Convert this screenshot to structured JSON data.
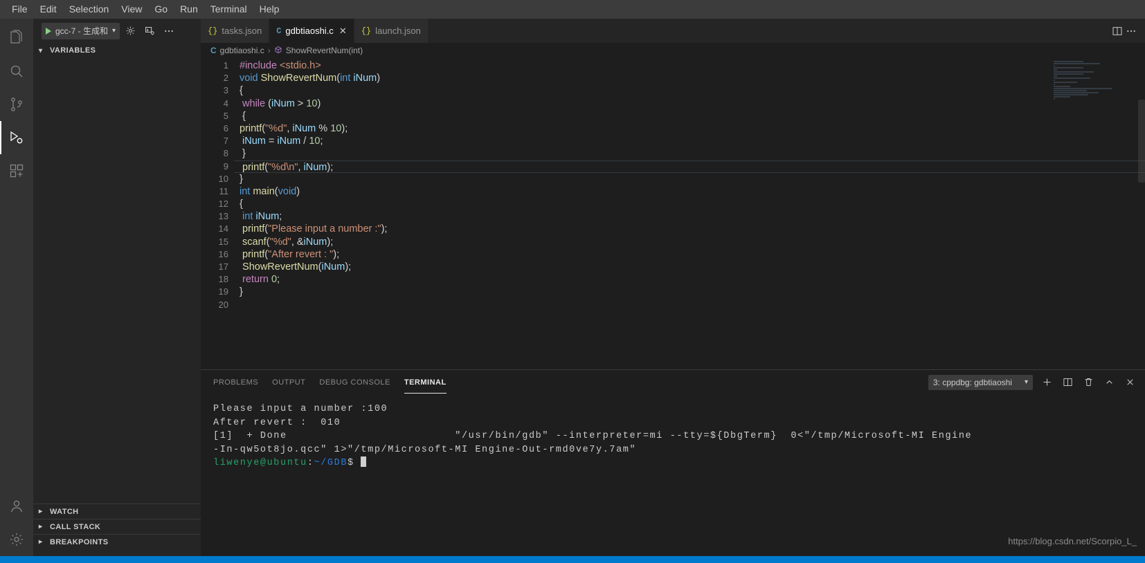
{
  "menubar": {
    "items": [
      {
        "label": "File"
      },
      {
        "label": "Edit"
      },
      {
        "label": "Selection"
      },
      {
        "label": "View"
      },
      {
        "label": "Go"
      },
      {
        "label": "Run"
      },
      {
        "label": "Terminal"
      },
      {
        "label": "Help"
      }
    ]
  },
  "activitybar": {
    "items": [
      {
        "name": "explorer",
        "icon": "files-icon"
      },
      {
        "name": "search",
        "icon": "search-icon"
      },
      {
        "name": "source-control",
        "icon": "source-control-icon"
      },
      {
        "name": "run-and-debug",
        "icon": "run-debug-icon",
        "active": true
      },
      {
        "name": "extensions",
        "icon": "extensions-icon"
      }
    ],
    "bottom": [
      {
        "name": "accounts",
        "icon": "account-icon"
      },
      {
        "name": "manage",
        "icon": "gear-icon"
      }
    ]
  },
  "debug_toolbar": {
    "launch_config": "gcc-7 - 生成和",
    "start_icon": "play-icon",
    "settings_icon": "gear-icon",
    "open_debug_console_icon": "debug-console-icon",
    "more_icon": "ellipsis-icon"
  },
  "sidebar": {
    "sections": [
      {
        "label": "VARIABLES",
        "expanded": true
      },
      {
        "label": "WATCH",
        "expanded": false
      },
      {
        "label": "CALL STACK",
        "expanded": false
      },
      {
        "label": "BREAKPOINTS",
        "expanded": false
      }
    ]
  },
  "tabs": [
    {
      "label": "tasks.json",
      "icon": "json",
      "icon_glyph": "{}",
      "active": false,
      "closable": false
    },
    {
      "label": "gdbtiaoshi.c",
      "icon": "c",
      "icon_glyph": "C",
      "active": true,
      "closable": true,
      "close_glyph": "✕"
    },
    {
      "label": "launch.json",
      "icon": "json",
      "icon_glyph": "{}",
      "active": false,
      "closable": false
    }
  ],
  "editor_actions": {
    "split_editor_icon": "split-editor-icon",
    "more_actions_icon": "ellipsis-icon"
  },
  "breadcrumb": {
    "file_icon_glyph": "C",
    "file": "gdbtiaoshi.c",
    "separator": "›",
    "symbol_icon": "symbol-method-icon",
    "symbol": "ShowRevertNum(int)"
  },
  "code": {
    "language": "c",
    "current_line": 9,
    "lines": [
      {
        "n": 1,
        "tokens": [
          {
            "t": "#include ",
            "c": "pp"
          },
          {
            "t": "<stdio.h>",
            "c": "inc"
          }
        ]
      },
      {
        "n": 2,
        "tokens": [
          {
            "t": "void ",
            "c": "kw"
          },
          {
            "t": "ShowRevertNum",
            "c": "fn"
          },
          {
            "t": "(",
            "c": "op"
          },
          {
            "t": "int ",
            "c": "kw"
          },
          {
            "t": "iNum",
            "c": "var"
          },
          {
            "t": ")",
            "c": "op"
          }
        ]
      },
      {
        "n": 3,
        "tokens": [
          {
            "t": "{",
            "c": "op"
          }
        ]
      },
      {
        "n": 4,
        "tokens": [
          {
            "t": " ",
            "c": "op"
          },
          {
            "t": "while",
            "c": "kw2"
          },
          {
            "t": " (",
            "c": "op"
          },
          {
            "t": "iNum",
            "c": "var"
          },
          {
            "t": " > ",
            "c": "op"
          },
          {
            "t": "10",
            "c": "num"
          },
          {
            "t": ")",
            "c": "op"
          }
        ]
      },
      {
        "n": 5,
        "tokens": [
          {
            "t": " {",
            "c": "op"
          }
        ]
      },
      {
        "n": 6,
        "tokens": [
          {
            "t": "printf",
            "c": "fn"
          },
          {
            "t": "(",
            "c": "op"
          },
          {
            "t": "\"%d\"",
            "c": "str"
          },
          {
            "t": ", ",
            "c": "op"
          },
          {
            "t": "iNum",
            "c": "var"
          },
          {
            "t": " % ",
            "c": "op"
          },
          {
            "t": "10",
            "c": "num"
          },
          {
            "t": ");",
            "c": "op"
          }
        ]
      },
      {
        "n": 7,
        "tokens": [
          {
            "t": " ",
            "c": "op"
          },
          {
            "t": "iNum",
            "c": "var"
          },
          {
            "t": " = ",
            "c": "op"
          },
          {
            "t": "iNum",
            "c": "var"
          },
          {
            "t": " / ",
            "c": "op"
          },
          {
            "t": "10",
            "c": "num"
          },
          {
            "t": ";",
            "c": "op"
          }
        ]
      },
      {
        "n": 8,
        "tokens": [
          {
            "t": " }",
            "c": "op"
          }
        ]
      },
      {
        "n": 9,
        "tokens": [
          {
            "t": " ",
            "c": "op"
          },
          {
            "t": "printf",
            "c": "fn"
          },
          {
            "t": "(",
            "c": "op"
          },
          {
            "t": "\"%d\\n\"",
            "c": "str"
          },
          {
            "t": ", ",
            "c": "op"
          },
          {
            "t": "iNum",
            "c": "var"
          },
          {
            "t": ");",
            "c": "op"
          }
        ]
      },
      {
        "n": 10,
        "tokens": [
          {
            "t": "}",
            "c": "op"
          }
        ]
      },
      {
        "n": 11,
        "tokens": [
          {
            "t": "int ",
            "c": "kw"
          },
          {
            "t": "main",
            "c": "fn"
          },
          {
            "t": "(",
            "c": "op"
          },
          {
            "t": "void",
            "c": "kw"
          },
          {
            "t": ")",
            "c": "op"
          }
        ]
      },
      {
        "n": 12,
        "tokens": [
          {
            "t": "{",
            "c": "op"
          }
        ]
      },
      {
        "n": 13,
        "tokens": [
          {
            "t": " ",
            "c": "op"
          },
          {
            "t": "int ",
            "c": "kw"
          },
          {
            "t": "iNum",
            "c": "var"
          },
          {
            "t": ";",
            "c": "op"
          }
        ]
      },
      {
        "n": 14,
        "tokens": [
          {
            "t": " ",
            "c": "op"
          },
          {
            "t": "printf",
            "c": "fn"
          },
          {
            "t": "(",
            "c": "op"
          },
          {
            "t": "\"Please input a number :\"",
            "c": "str"
          },
          {
            "t": ");",
            "c": "op"
          }
        ]
      },
      {
        "n": 15,
        "tokens": [
          {
            "t": " ",
            "c": "op"
          },
          {
            "t": "scanf",
            "c": "fn"
          },
          {
            "t": "(",
            "c": "op"
          },
          {
            "t": "\"%d\"",
            "c": "str"
          },
          {
            "t": ", &",
            "c": "op"
          },
          {
            "t": "iNum",
            "c": "var"
          },
          {
            "t": ");",
            "c": "op"
          }
        ]
      },
      {
        "n": 16,
        "tokens": [
          {
            "t": " ",
            "c": "op"
          },
          {
            "t": "printf",
            "c": "fn"
          },
          {
            "t": "(",
            "c": "op"
          },
          {
            "t": "\"After revert : \"",
            "c": "str"
          },
          {
            "t": ");",
            "c": "op"
          }
        ]
      },
      {
        "n": 17,
        "tokens": [
          {
            "t": " ",
            "c": "op"
          },
          {
            "t": "ShowRevertNum",
            "c": "fn"
          },
          {
            "t": "(",
            "c": "op"
          },
          {
            "t": "iNum",
            "c": "var"
          },
          {
            "t": ");",
            "c": "op"
          }
        ]
      },
      {
        "n": 18,
        "tokens": [
          {
            "t": " ",
            "c": "op"
          },
          {
            "t": "return",
            "c": "kw2"
          },
          {
            "t": " ",
            "c": "op"
          },
          {
            "t": "0",
            "c": "num"
          },
          {
            "t": ";",
            "c": "op"
          }
        ]
      },
      {
        "n": 19,
        "tokens": [
          {
            "t": "}",
            "c": "op"
          }
        ]
      },
      {
        "n": 20,
        "tokens": []
      }
    ]
  },
  "panel": {
    "tabs": [
      {
        "label": "PROBLEMS",
        "active": false
      },
      {
        "label": "OUTPUT",
        "active": false
      },
      {
        "label": "DEBUG CONSOLE",
        "active": false
      },
      {
        "label": "TERMINAL",
        "active": true
      }
    ],
    "terminal_selector": {
      "value": "3: cppdbg: gdbtiaoshi",
      "chevron": "⌄"
    },
    "actions": [
      {
        "name": "new-terminal-icon",
        "glyph": "+"
      },
      {
        "name": "split-terminal-icon",
        "glyph": "◫"
      },
      {
        "name": "kill-terminal-icon",
        "glyph": "🗑"
      },
      {
        "name": "maximize-panel-icon",
        "glyph": "⌃"
      },
      {
        "name": "close-panel-icon",
        "glyph": "✕"
      }
    ]
  },
  "terminal": {
    "lines": [
      {
        "segments": [
          {
            "text": "Please input a number :100",
            "color": "plain"
          }
        ]
      },
      {
        "segments": [
          {
            "text": "After revert :  010",
            "color": "plain"
          }
        ]
      },
      {
        "segments": [
          {
            "text": "[1]  + Done                         \"/usr/bin/gdb\" --interpreter=mi --tty=${DbgTerm}  0<\"/tmp/Microsoft-MI Engine",
            "color": "plain"
          }
        ]
      },
      {
        "segments": [
          {
            "text": "-In-qw5ot8jo.qcc\" 1>\"/tmp/Microsoft-MI Engine-Out-rmd0ve7y.7am\"",
            "color": "plain"
          }
        ]
      },
      {
        "segments": [
          {
            "text": "liwenye@ubuntu",
            "color": "green"
          },
          {
            "text": ":",
            "color": "plain"
          },
          {
            "text": "~/GDB",
            "color": "blue"
          },
          {
            "text": "$ ",
            "color": "plain"
          },
          {
            "text": "█",
            "color": "cursor"
          }
        ]
      }
    ]
  },
  "watermark": {
    "text": "https://blog.csdn.net/Scorpio_L_"
  }
}
